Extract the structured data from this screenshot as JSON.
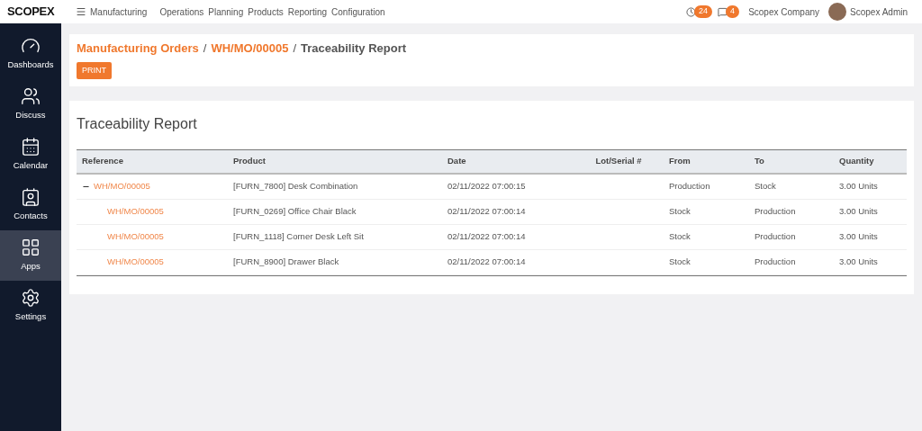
{
  "logo": {
    "text": "SCOPEX"
  },
  "topbar": {
    "app": "Manufacturing",
    "menu": [
      "Operations",
      "Planning",
      "Products",
      "Reporting",
      "Configuration"
    ],
    "activity_count": "24",
    "message_count": "4",
    "company": "Scopex Company",
    "user": "Scopex Admin"
  },
  "sidebar": {
    "items": [
      {
        "label": "Dashboards",
        "selected": false
      },
      {
        "label": "Discuss",
        "selected": false
      },
      {
        "label": "Calendar",
        "selected": false
      },
      {
        "label": "Contacts",
        "selected": false
      },
      {
        "label": "Apps",
        "selected": true
      },
      {
        "label": "Settings",
        "selected": false
      }
    ]
  },
  "breadcrumb": [
    {
      "label": "Manufacturing Orders"
    },
    {
      "separator": "/",
      "label": "WH/MO/00005"
    },
    {
      "separator": "/",
      "label": "Traceability Report"
    }
  ],
  "print_button": "PRINT",
  "report": {
    "title": "Traceability Report",
    "columns": [
      "Reference",
      "Product",
      "Date",
      "Lot/Serial #",
      "From",
      "To",
      "Quantity"
    ],
    "rows": [
      {
        "reference": "WH/MO/00005",
        "product": "[FURN_7800] Desk Combination",
        "date": "02/11/2022 07:00:15",
        "from": "Production",
        "to": "Stock",
        "quantity": "3.00 Units",
        "expanded": true,
        "children": [
          {
            "reference": "WH/MO/00005",
            "product": "[FURN_0269] Office Chair Black",
            "date": "02/11/2022 07:00:14",
            "from": "Stock",
            "to": "Production",
            "quantity": "3.00 Units"
          },
          {
            "reference": "WH/MO/00005",
            "product": "[FURN_1118] Corner Desk Left Sit",
            "date": "02/11/2022 07:00:14",
            "from": "Stock",
            "to": "Production",
            "quantity": "3.00 Units"
          },
          {
            "reference": "WH/MO/00005",
            "product": "[FURN_8900] Drawer Black",
            "date": "02/11/2022 07:00:14",
            "from": "Stock",
            "to": "Production",
            "quantity": "3.00 Units"
          }
        ]
      }
    ]
  }
}
